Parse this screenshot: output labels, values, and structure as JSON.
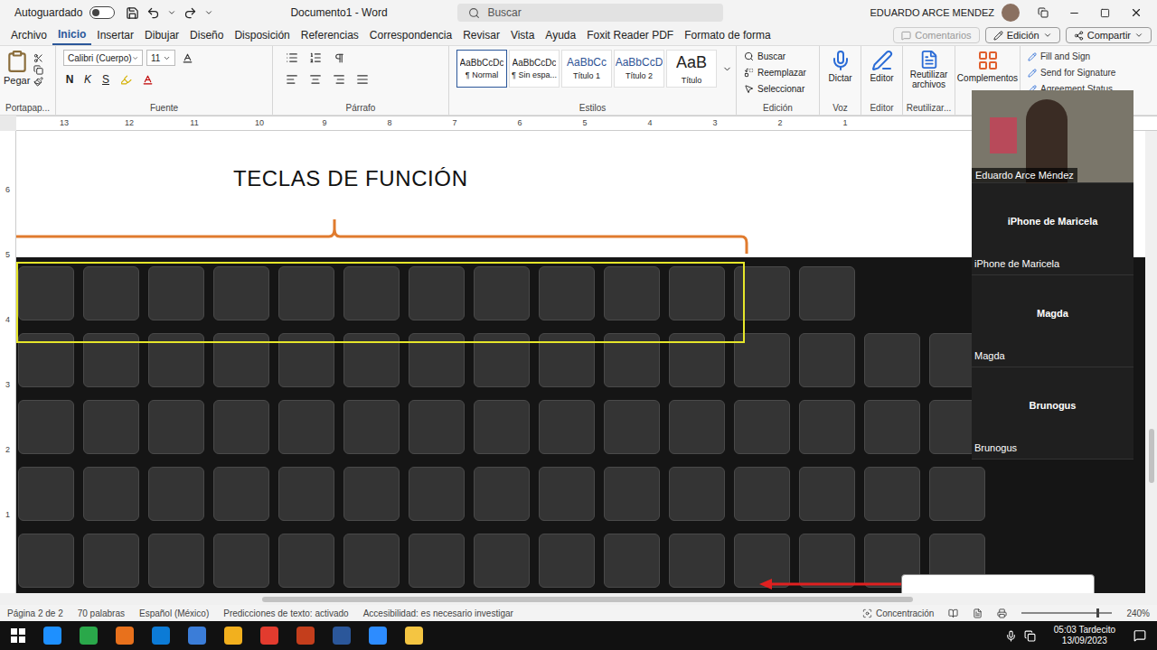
{
  "window": {
    "title": "Documento1 - Word"
  },
  "title_bar": {
    "autosave_label": "Autoguardado",
    "autosave_on": false,
    "search_placeholder": "Buscar",
    "user": "EDUARDO ARCE MENDEZ"
  },
  "menu_tabs": [
    {
      "label": "Archivo",
      "selected": false
    },
    {
      "label": "Inicio",
      "selected": true
    },
    {
      "label": "Insertar",
      "selected": false
    },
    {
      "label": "Dibujar",
      "selected": false
    },
    {
      "label": "Diseño",
      "selected": false
    },
    {
      "label": "Disposición",
      "selected": false
    },
    {
      "label": "Referencias",
      "selected": false
    },
    {
      "label": "Correspondencia",
      "selected": false
    },
    {
      "label": "Revisar",
      "selected": false
    },
    {
      "label": "Vista",
      "selected": false
    },
    {
      "label": "Ayuda",
      "selected": false
    },
    {
      "label": "Foxit Reader PDF",
      "selected": false
    },
    {
      "label": "Formato de forma",
      "selected": false
    }
  ],
  "menu_actions": [
    {
      "label": "Comentarios",
      "disabled": true
    },
    {
      "label": "Edición",
      "disabled": false
    },
    {
      "label": "Compartir",
      "disabled": false
    }
  ],
  "ribbon": {
    "clipboard": {
      "button": "Pegar",
      "group": "Portapap..."
    },
    "font": {
      "name": "Calibri (Cuerpo)",
      "size": "11",
      "format_buttons": [
        "N",
        "K",
        "S"
      ],
      "group": "Fuente"
    },
    "paragraph": {
      "group": "Párrafo"
    },
    "styles": {
      "group": "Estilos",
      "items": [
        {
          "preview": "AaBbCcDc",
          "label": "¶ Normal",
          "selected": true
        },
        {
          "preview": "AaBbCcDc",
          "label": "¶ Sin espa...",
          "selected": false
        },
        {
          "preview": "AaBbCc",
          "label": "Título 1",
          "selected": false
        },
        {
          "preview": "AaBbCcD",
          "label": "Título 2",
          "selected": false
        },
        {
          "preview": "AaB",
          "label": "Título",
          "selected": false
        }
      ]
    },
    "editing": {
      "group": "Edición",
      "items": [
        "Buscar",
        "Reemplazar",
        "Seleccionar"
      ]
    },
    "voice": {
      "group": "Voz",
      "button": "Dictar"
    },
    "editor": {
      "group": "Editor",
      "button": "Editor"
    },
    "reuse": {
      "group": "Reutilizar...",
      "button_lines": [
        "Reutilizar",
        "archivos"
      ]
    },
    "addins": {
      "button": "Complementos"
    },
    "foxit": [
      "Fill and Sign",
      "Send for Signature",
      "Agreement Status"
    ]
  },
  "ruler": [
    "13",
    "12",
    "11",
    "10",
    "9",
    "8",
    "7",
    "6",
    "5",
    "4",
    "3",
    "2",
    "1"
  ],
  "vertical_ruler": [
    "6",
    "5",
    "4",
    "3",
    "2",
    "1"
  ],
  "document": {
    "heading": "TECLAS DE FUNCIÓN"
  },
  "status_bar": {
    "items": [
      "Página 2 de 2",
      "70 palabras",
      "Español (México)",
      "Predicciones de texto: activado",
      "Accesibilidad: es necesario investigar"
    ],
    "focus": "Concentración",
    "zoom": "240%"
  },
  "taskbar": {
    "time": "05:03 Tardecito",
    "date": "13/09/2023"
  },
  "meeting": {
    "participants": [
      {
        "name": "Eduardo Arce Méndez",
        "kind": "video"
      },
      {
        "name": "iPhone de Maricela",
        "kind": "tile"
      },
      {
        "name": "Magda",
        "kind": "tile"
      },
      {
        "name": "Brunogus",
        "kind": "tile"
      }
    ]
  }
}
